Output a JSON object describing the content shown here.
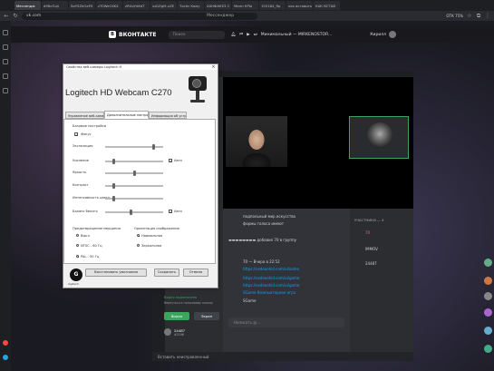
{
  "browser": {
    "tabs": [
      {
        "label": "Мессендж",
        "active": true
      },
      {
        "label": "d98cf1qt"
      },
      {
        "label": "SaYSZkOaPX"
      },
      {
        "label": "zT0WeC6KX"
      },
      {
        "label": "zRXqYdKdT"
      },
      {
        "label": "vzDZgM-xZE"
      },
      {
        "label": "Тосёс Кому"
      },
      {
        "label": "ХАНФАКЕЗ С"
      },
      {
        "label": "Мапп КРЫ"
      },
      {
        "label": "150184_Яр"
      },
      {
        "label": "как вставить"
      },
      {
        "label": "КАК ВСТАВ"
      }
    ],
    "url": "vk.com",
    "zoom": "75%",
    "zoom_sub": "ОТК"
  },
  "vk": {
    "logo_text": "ВКОНТАКТЕ",
    "search_placeholder": "Поиск",
    "player_text": "Минимальный — MIRKENOSTOR...",
    "user_name": "Кирилл",
    "messenger_title": "Мессенджер"
  },
  "dialog": {
    "title": "Свойства веб-камеры Logitech H",
    "heading": "Logitech HD Webcam C270",
    "tabs": [
      "Управление веб-камерой",
      "Дополнительные настройки",
      "Информация об устройстве"
    ],
    "basic_label": "Базовые настройки",
    "auto_focus_label": "Фокус",
    "sliders": [
      {
        "label": "Экспозиция",
        "value": 0.85,
        "auto": false
      },
      {
        "label": "Усиление",
        "value": 0.13,
        "auto": true,
        "auto_label": "Авто"
      },
      {
        "label": "Яркость",
        "value": 0.5,
        "auto": false
      },
      {
        "label": "Контраст",
        "value": 0.13,
        "auto": false
      },
      {
        "label": "Интенсивность цвета",
        "value": 0.13,
        "auto": false
      },
      {
        "label": "Баланс белого",
        "value": 0.45,
        "auto": true,
        "auto_label": "Авто"
      }
    ],
    "flicker_label": "Предотвращение мерцания",
    "flicker_options": [
      "Выкл",
      "NTSC - 60 Гц",
      "PAL - 50 Гц"
    ],
    "flicker_selected": 2,
    "orient_label": "Ориентация изображения",
    "orient_options": [
      "Нормальная",
      "Зеркальная"
    ],
    "orient_selected": 0,
    "buttons": {
      "restore": "Восстановить умолчания",
      "save": "Сохранить",
      "cancel": "Отмена"
    },
    "logo_text": "logitech"
  },
  "discord": {
    "chat_lines": [
      {
        "text": "подпольный мир искусства",
        "type": "text"
      },
      {
        "text": "формы голоса имеют",
        "type": "text"
      },
      {
        "text": "▬▬▬▬▬▬▬▬ добавил 70 в группу",
        "type": "text"
      },
      {
        "text": "70 — Вчера в 22:52",
        "type": "text"
      },
      {
        "text": "https://vsdeoohid.com/ui/some",
        "type": "link"
      },
      {
        "text": "https://vsdeoohid.com/ui/game",
        "type": "link"
      },
      {
        "text": "https://vsdeoohid.com/ui/game",
        "type": "link"
      },
      {
        "text": "SGame Компьютерная игра",
        "type": "link"
      },
      {
        "text": "SGame",
        "type": "text"
      }
    ],
    "members_header": "УЧАСТНИКИ — 4",
    "members": [
      "70",
      "IMMOV",
      "24487"
    ],
    "voice_status": "Видео подключено",
    "voice_sub": "Вернуться к голосовому каналу",
    "buttons": {
      "video": "Видео",
      "screen": "Экран"
    },
    "user_name": "24487",
    "user_tag": "#2196",
    "chat_placeholder": "Написать @...",
    "bottom_text": "Вставить неисправленный"
  }
}
